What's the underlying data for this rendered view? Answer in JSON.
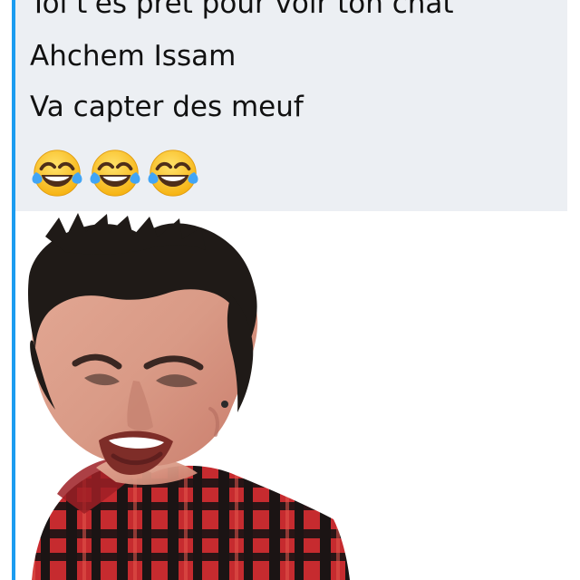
{
  "message": {
    "lines": [
      "Toi t'es prêt pour voir ton chat",
      "Ahchem Issam",
      "Va capter des meuf"
    ],
    "emoji": {
      "name": "face-with-tears-of-joy",
      "count": 3
    }
  },
  "colors": {
    "accent": "#1c9cf0",
    "text_background": "#eceff3",
    "text": "#111111",
    "shirt_red": "#c62b2f",
    "hair": "#1f1a17",
    "skin": "#d99a86"
  },
  "image": {
    "subject": "crying-man-reaction-photo"
  }
}
